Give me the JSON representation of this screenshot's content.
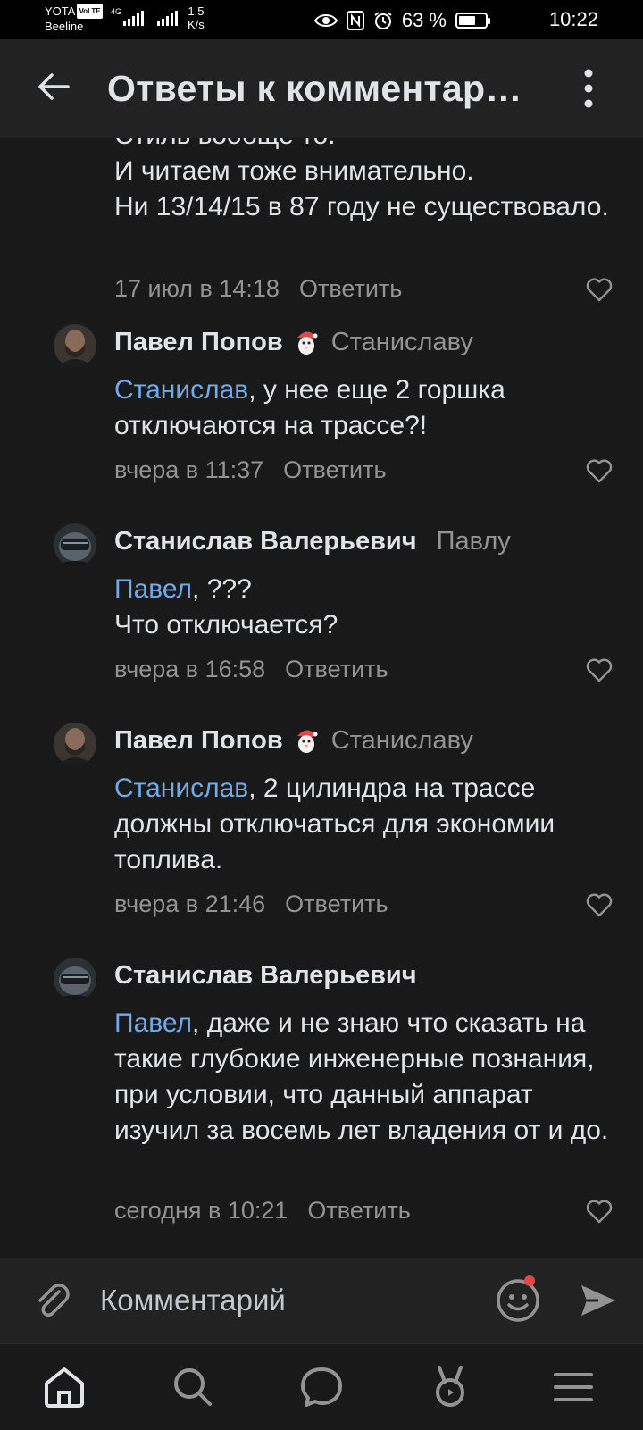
{
  "status_bar": {
    "carrier1": "YOTA",
    "volte": "VoLTE",
    "net": "4G",
    "carrier2": "Beeline",
    "speed_value": "1,5",
    "speed_unit": "K/s",
    "battery": "63 %",
    "battery_level": 0.63,
    "time": "10:22"
  },
  "header": {
    "title": "Ответы к комментарию"
  },
  "comments": [
    {
      "partial_line": "Стиль вообще то.",
      "text": "И читаем тоже внимательно.\nНи 13/14/15 в 87 году не существовало.",
      "time": "17 июл в 14:18",
      "reply_label": "Ответить"
    },
    {
      "author": "Павел Попов",
      "reply_to": "Станиславу",
      "mention": "Станислав",
      "text": ", у нее еще 2 горшка отключаются на трассе?!",
      "time": "вчера в 11:37",
      "reply_label": "Ответить"
    },
    {
      "author": "Станислав Валерьевич",
      "reply_to": "Павлу",
      "mention": "Павел",
      "text": ", ???\nЧто отключается?",
      "time": "вчера в 16:58",
      "reply_label": "Ответить"
    },
    {
      "author": "Павел Попов",
      "reply_to": "Станиславу",
      "mention": "Станислав",
      "text": ", 2 цилиндра на трассе должны отключаться для экономии топлива.",
      "time": "вчера в 21:46",
      "reply_label": "Ответить"
    },
    {
      "author": "Станислав Валерьевич",
      "reply_to": "",
      "mention": "Павел",
      "text": ", даже и не знаю что сказать на такие глубокие инженерные познания, при условии, что данный аппарат изучил за восемь лет владения от и до.",
      "time": "сегодня в 10:21",
      "reply_label": "Ответить"
    }
  ],
  "composer": {
    "placeholder": "Комментарий"
  },
  "bottom_nav": [
    "home-icon",
    "search-icon",
    "messages-icon",
    "clips-icon",
    "menu-icon"
  ],
  "colors": {
    "background": "#19191a",
    "header": "#222223",
    "text": "#e1e3e6",
    "secondary": "#939393",
    "mention": "#71aaeb",
    "badge": "#e64646"
  }
}
